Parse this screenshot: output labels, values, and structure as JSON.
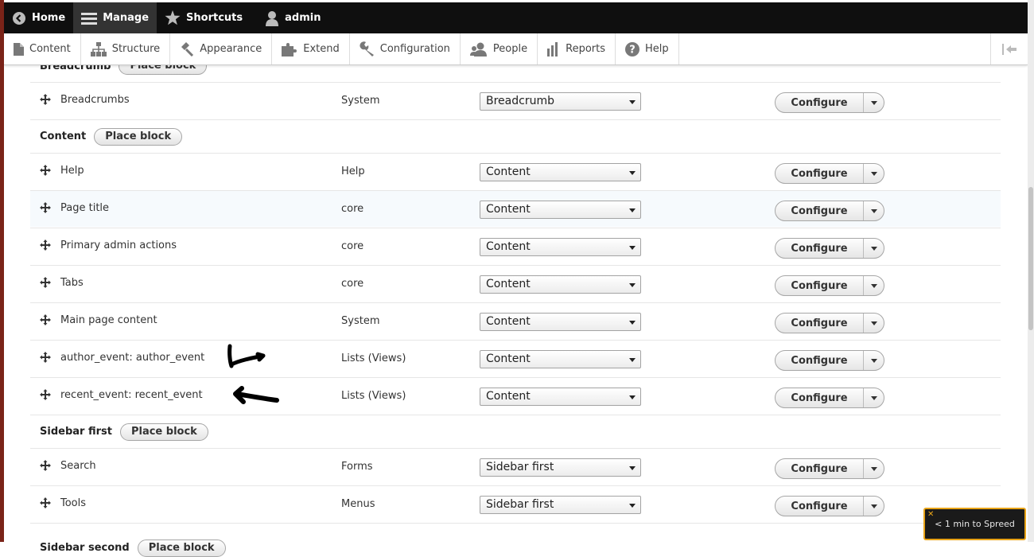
{
  "toolbar": {
    "items": [
      {
        "label": "Home",
        "icon": "back-circle-icon"
      },
      {
        "label": "Manage",
        "icon": "hamburger-icon",
        "active": true
      },
      {
        "label": "Shortcuts",
        "icon": "star-icon"
      },
      {
        "label": "admin",
        "icon": "user-icon"
      }
    ]
  },
  "tray": {
    "items": [
      {
        "label": "Content",
        "icon": "page-icon"
      },
      {
        "label": "Structure",
        "icon": "sitemap-icon"
      },
      {
        "label": "Appearance",
        "icon": "brush-icon"
      },
      {
        "label": "Extend",
        "icon": "puzzle-icon"
      },
      {
        "label": "Configuration",
        "icon": "wrench-icon"
      },
      {
        "label": "People",
        "icon": "people-icon"
      },
      {
        "label": "Reports",
        "icon": "bar-chart-icon"
      },
      {
        "label": "Help",
        "icon": "question-icon"
      }
    ],
    "collapse_icon": "collapse-tray-icon"
  },
  "place_block_label": "Place block",
  "configure_label": "Configure",
  "regions": {
    "breadcrumb": {
      "title": "Breadcrumb",
      "blocks": [
        {
          "name": "Breadcrumbs",
          "category": "System",
          "region": "Breadcrumb"
        }
      ]
    },
    "content": {
      "title": "Content",
      "blocks": [
        {
          "name": "Help",
          "category": "Help",
          "region": "Content"
        },
        {
          "name": "Page title",
          "category": "core",
          "region": "Content"
        },
        {
          "name": "Primary admin actions",
          "category": "core",
          "region": "Content"
        },
        {
          "name": "Tabs",
          "category": "core",
          "region": "Content"
        },
        {
          "name": "Main page content",
          "category": "System",
          "region": "Content"
        },
        {
          "name": "author_event: author_event",
          "category": "Lists (Views)",
          "region": "Content"
        },
        {
          "name": "recent_event: recent_event",
          "category": "Lists (Views)",
          "region": "Content"
        }
      ]
    },
    "sidebar_first": {
      "title": "Sidebar first",
      "blocks": [
        {
          "name": "Search",
          "category": "Forms",
          "region": "Sidebar first"
        },
        {
          "name": "Tools",
          "category": "Menus",
          "region": "Sidebar first"
        }
      ]
    },
    "sidebar_second": {
      "title": "Sidebar second"
    }
  },
  "notification": {
    "text": "< 1 min to Spreed",
    "close_icon": "close-icon"
  }
}
